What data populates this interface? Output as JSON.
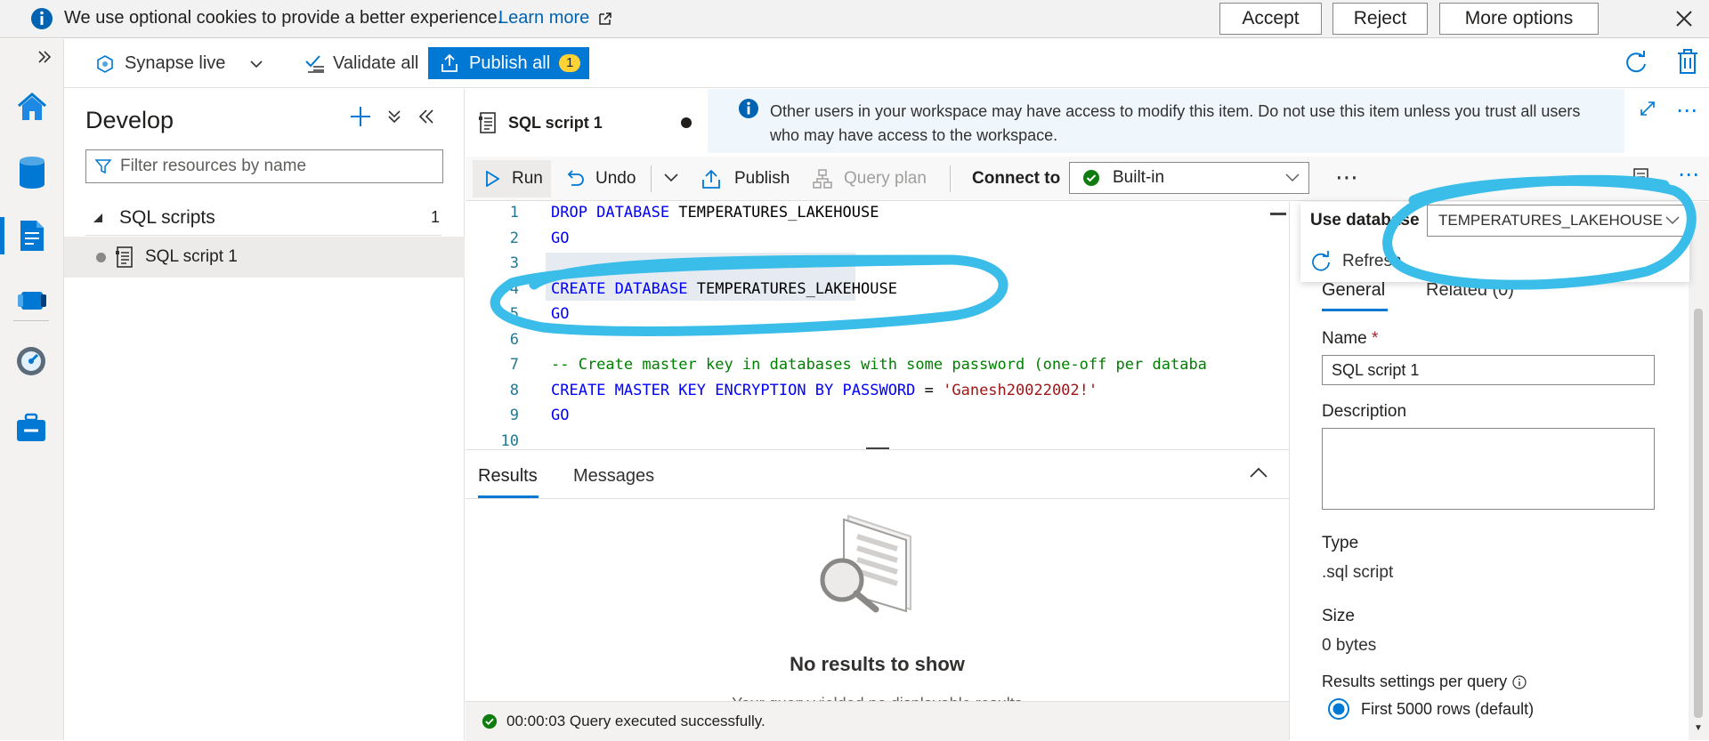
{
  "cookie_banner": {
    "message": "We use optional cookies to provide a better experience.",
    "learn_more": "Learn more",
    "accept": "Accept",
    "reject": "Reject",
    "more_options": "More options"
  },
  "toolbar": {
    "mode": "Synapse live",
    "validate_all": "Validate all",
    "publish_all": "Publish all",
    "publish_count": "1"
  },
  "develop": {
    "title": "Develop",
    "filter_placeholder": "Filter resources by name",
    "section_label": "SQL scripts",
    "section_count": "1",
    "items": [
      {
        "label": "SQL script 1"
      }
    ]
  },
  "editor": {
    "tab_label": "SQL script 1",
    "info_message": "Other users in your workspace may have access to modify this item. Do not use this item unless you trust all users who may have access to the workspace.",
    "commands": {
      "run": "Run",
      "undo": "Undo",
      "publish": "Publish",
      "query_plan": "Query plan",
      "connect_to_label": "Connect to",
      "connect_to_value": "Built-in",
      "use_database_label": "Use database",
      "use_database_value": "TEMPERATURES_LAKEHOUSE",
      "refresh": "Refresh"
    },
    "code_lines": [
      {
        "num": "1",
        "tokens": [
          [
            "kw",
            "DROP DATABASE "
          ],
          [
            "id",
            "TEMPERATURES_LAKEHOUSE"
          ]
        ]
      },
      {
        "num": "2",
        "tokens": [
          [
            "kw",
            "GO"
          ]
        ]
      },
      {
        "num": "3",
        "tokens": []
      },
      {
        "num": "4",
        "tokens": [
          [
            "kw",
            "CREATE DATABASE "
          ],
          [
            "id",
            "TEMPERATURES_LAKEHOUSE"
          ]
        ]
      },
      {
        "num": "5",
        "tokens": [
          [
            "kw",
            "GO"
          ]
        ]
      },
      {
        "num": "6",
        "tokens": []
      },
      {
        "num": "7",
        "tokens": [
          [
            "cm",
            "-- Create master key in databases with some password (one-off per databa"
          ]
        ]
      },
      {
        "num": "8",
        "tokens": [
          [
            "kw",
            "CREATE MASTER KEY ENCRYPTION BY PASSWORD "
          ],
          [
            "id",
            "= "
          ],
          [
            "st",
            "'Ganesh20022002!'"
          ]
        ]
      },
      {
        "num": "9",
        "tokens": [
          [
            "kw",
            "GO"
          ]
        ]
      },
      {
        "num": "10",
        "tokens": []
      }
    ]
  },
  "results": {
    "tab_results": "Results",
    "tab_messages": "Messages",
    "empty_title": "No results to show",
    "empty_subtitle": "Your query yielded no displayable results",
    "status": "00:00:03 Query executed successfully."
  },
  "properties": {
    "tab_general": "General",
    "tab_related": "Related (0)",
    "name_label": "Name",
    "required_marker": "*",
    "name_value": "SQL script 1",
    "description_label": "Description",
    "description_value": "",
    "type_label": "Type",
    "type_value": ".sql script",
    "size_label": "Size",
    "size_value": "0 bytes",
    "results_settings_label": "Results settings per query",
    "results_option": "First 5000 rows (default)"
  },
  "colors": {
    "accent": "#0078d4",
    "annotation": "#3bbde9",
    "success": "#107c10",
    "badge": "#ffd335"
  }
}
